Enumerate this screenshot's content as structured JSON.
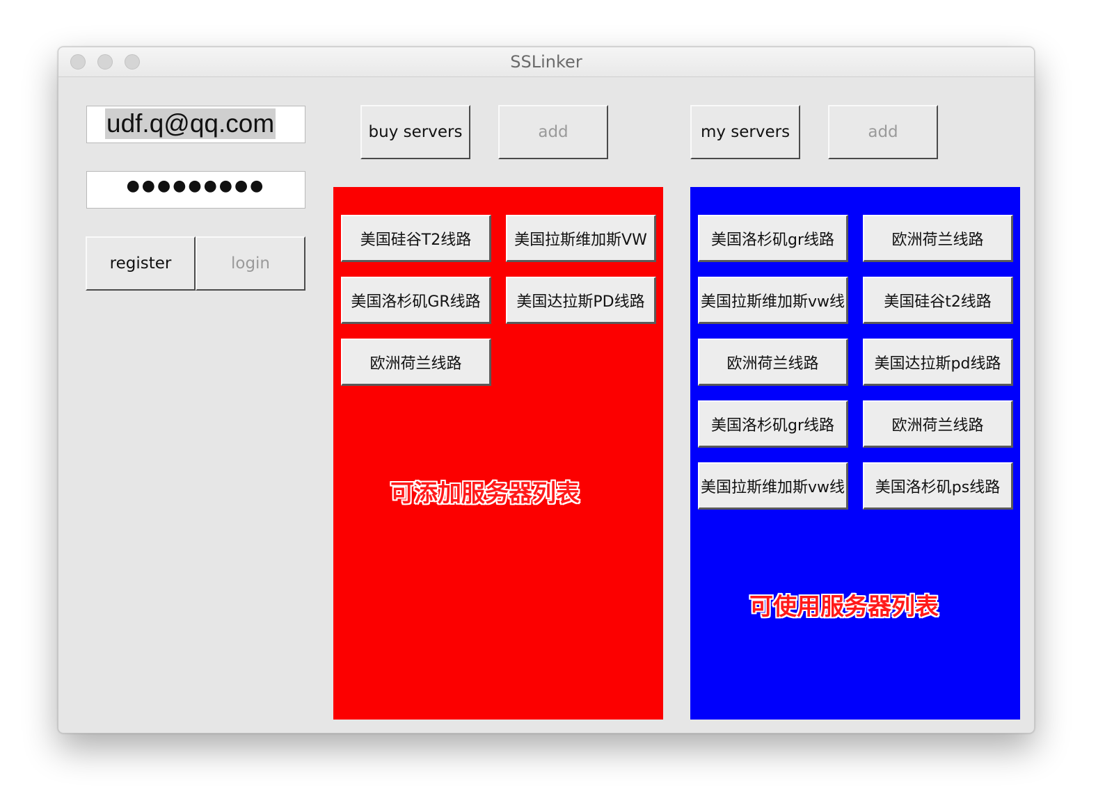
{
  "window": {
    "title": "SSLinker"
  },
  "login": {
    "email_value": "udf.q@qq.com",
    "password_masked": "●●●●●●●●●",
    "register_label": "register",
    "login_label": "login"
  },
  "toolbar": {
    "buy_servers_label": "buy servers",
    "buy_add_label": "add",
    "my_servers_label": "my servers",
    "my_add_label": "add"
  },
  "buy_panel": {
    "color": "#fc0000",
    "caption": "可添加服务器列表",
    "servers": [
      "美国硅谷T2线路",
      "美国拉斯维加斯VW",
      "美国洛杉矶GR线路",
      "美国达拉斯PD线路",
      "欧洲荷兰线路"
    ]
  },
  "my_panel": {
    "color": "#0000fc",
    "caption": "可使用服务器列表",
    "servers": [
      "美国洛杉矶gr线路",
      "欧洲荷兰线路",
      "美国拉斯维加斯vw线",
      "美国硅谷t2线路",
      "欧洲荷兰线路",
      "美国达拉斯pd线路",
      "美国洛杉矶gr线路",
      "欧洲荷兰线路",
      "美国拉斯维加斯vw线",
      "美国洛杉矶ps线路"
    ]
  }
}
